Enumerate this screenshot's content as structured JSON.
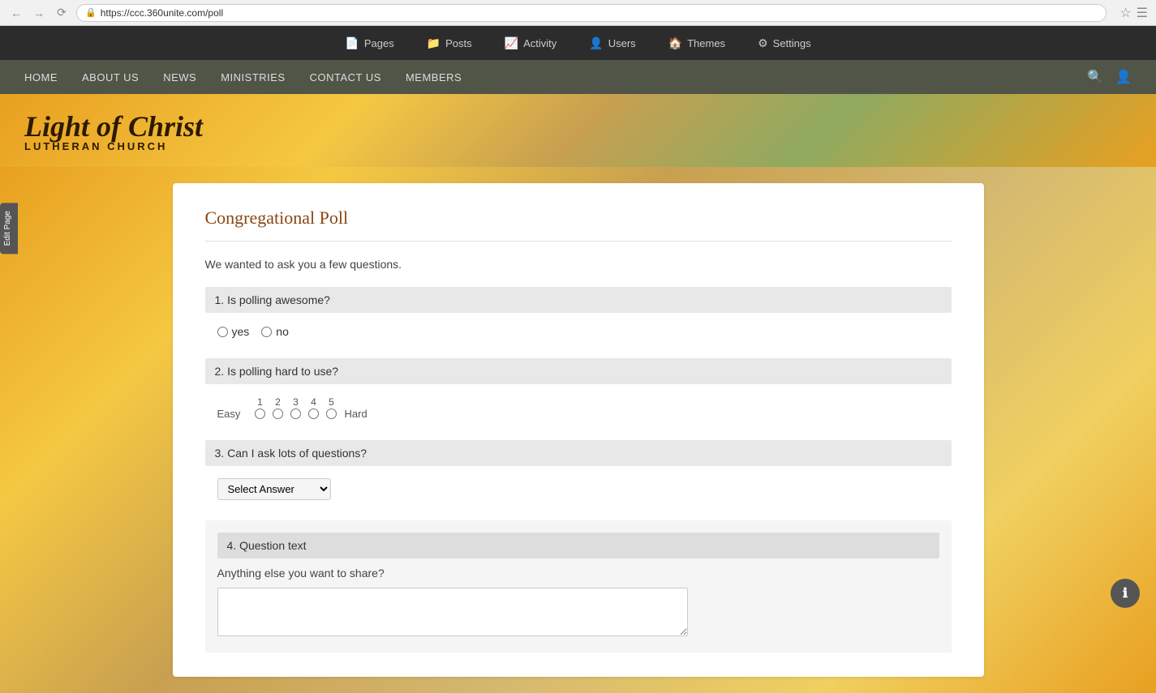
{
  "browser": {
    "url": "https://ccc.360unite.com/poll",
    "lock_icon": "🔒"
  },
  "admin_toolbar": {
    "items": [
      {
        "id": "pages",
        "icon": "📄",
        "label": "Pages"
      },
      {
        "id": "posts",
        "icon": "📁",
        "label": "Posts"
      },
      {
        "id": "activity",
        "icon": "📈",
        "label": "Activity"
      },
      {
        "id": "users",
        "icon": "👤",
        "label": "Users"
      },
      {
        "id": "themes",
        "icon": "🏠",
        "label": "Themes"
      },
      {
        "id": "settings",
        "icon": "⚙",
        "label": "Settings"
      }
    ]
  },
  "site_nav": {
    "links": [
      {
        "id": "home",
        "label": "HOME"
      },
      {
        "id": "about",
        "label": "ABOUT US"
      },
      {
        "id": "news",
        "label": "NEWS"
      },
      {
        "id": "ministries",
        "label": "MINISTRIES"
      },
      {
        "id": "contact",
        "label": "CONTACT US"
      },
      {
        "id": "members",
        "label": "MEMBERS"
      }
    ]
  },
  "site": {
    "title_main": "Light of Christ",
    "title_sub": "LUTHERAN CHURCH"
  },
  "edit_page_tab": "Edit Page",
  "poll": {
    "title": "Congregational Poll",
    "intro": "We wanted to ask you a few questions.",
    "questions": [
      {
        "number": "1.",
        "text": "Is polling awesome?",
        "type": "radio",
        "options": [
          "yes",
          "no"
        ]
      },
      {
        "number": "2.",
        "text": "Is polling hard to use?",
        "type": "scale",
        "min_label": "Easy",
        "max_label": "Hard",
        "scale": [
          1,
          2,
          3,
          4,
          5
        ]
      },
      {
        "number": "3.",
        "text": "Can I ask lots of questions?",
        "type": "dropdown",
        "default_option": "Select Answer"
      },
      {
        "number": "4.",
        "text": "Question text",
        "type": "open",
        "sub_label": "Anything else you want to share?"
      }
    ]
  },
  "info_button_icon": "ℹ"
}
